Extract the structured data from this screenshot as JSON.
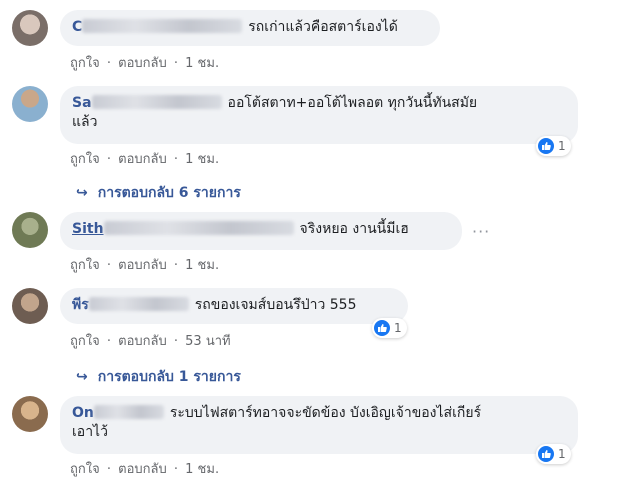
{
  "colors": {
    "bubble": "#f0f2f5",
    "link": "#385898",
    "meta": "#65676b",
    "like": "#1877f2"
  },
  "actions": {
    "like": "ถูกใจ",
    "reply": "ตอบกลับ",
    "sep": "·"
  },
  "comments": [
    {
      "author": "C",
      "text": "รถเก่าแล้วคือสตาร์เองได้",
      "time": "1 ชม."
    },
    {
      "author": "Sa",
      "text_line1": "ออโต้สตาท+ออโต้ไพลอต ทุกวันนี้ทันสมัย",
      "text_line2": "แล้ว",
      "time": "1 ชม.",
      "reactions": "1",
      "replies": "การตอบกลับ 6 รายการ"
    },
    {
      "author": "Sith",
      "text": "จริงหยอ งานนี้มีเฮ",
      "time": "1 ชม.",
      "more": "···"
    },
    {
      "author": "พีร",
      "text": "รถของเจมส์บอนรึป่าว 555",
      "time": "53 นาที",
      "reactions": "1",
      "replies": "การตอบกลับ 1 รายการ"
    },
    {
      "author": "On",
      "text_line1": "ระบบไฟสตาร์ทอาจจะขัดข้อง บังเอิญเจ้าของไส่เกียร์",
      "text_line2": "เอาไว้",
      "time": "1 ชม.",
      "reactions": "1"
    }
  ]
}
